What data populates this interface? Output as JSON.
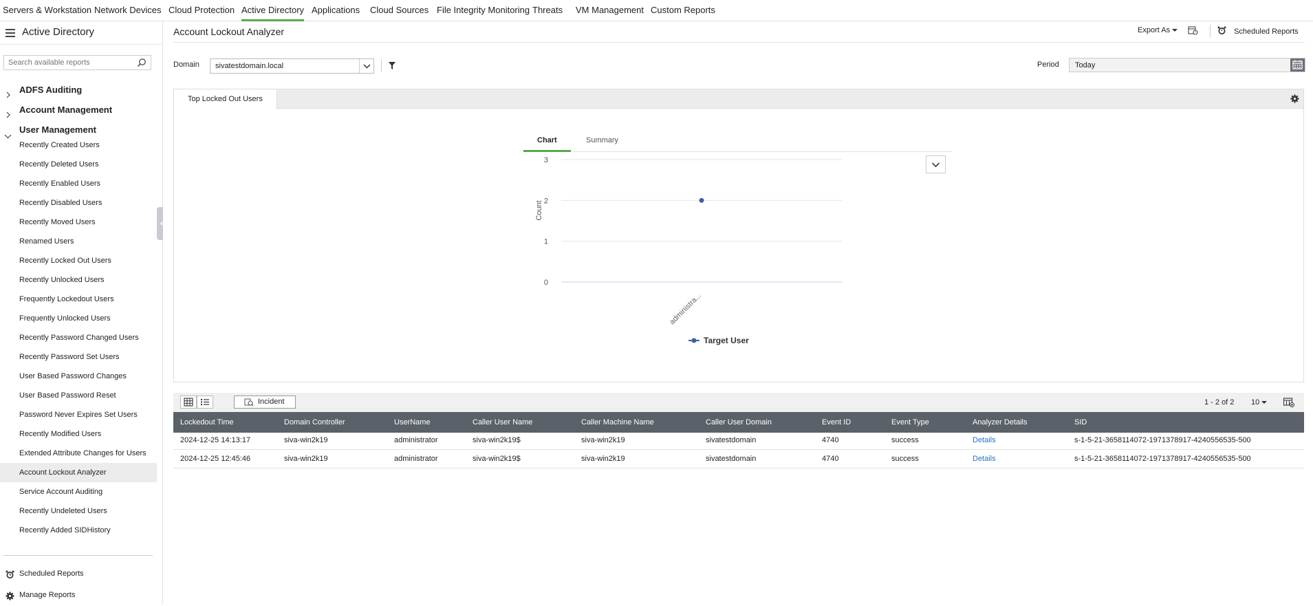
{
  "top_nav": [
    "Servers & Workstation",
    "Network Devices",
    "Cloud Protection",
    "Active Directory",
    "Applications",
    "Cloud Sources",
    "File Integrity Monitoring",
    "Threats",
    "VM Management",
    "Custom Reports"
  ],
  "top_nav_active": "Active Directory",
  "sidebar": {
    "title": "Active Directory",
    "search_placeholder": "Search available reports",
    "categories": [
      "ADFS Auditing",
      "Account Management",
      "User Management"
    ],
    "items": [
      "Recently Created Users",
      "Recently Deleted Users",
      "Recently Enabled Users",
      "Recently Disabled Users",
      "Recently Moved Users",
      "Renamed Users",
      "Recently Locked Out Users",
      "Recently Unlocked Users",
      "Frequently Lockedout Users",
      "Frequently Unlocked Users",
      "Recently Password Changed Users",
      "Recently Password Set Users",
      "User Based Password Changes",
      "User Based Password Reset",
      "Password Never Expires Set Users",
      "Recently Modified Users",
      "Extended Attribute Changes for Users",
      "Account Lockout Analyzer",
      "Service Account Auditing",
      "Recently Undeleted Users",
      "Recently Added SIDHistory"
    ],
    "active_item": "Account Lockout Analyzer",
    "bottom": {
      "scheduled": "Scheduled Reports",
      "manage": "Manage Reports"
    }
  },
  "header": {
    "title": "Account Lockout Analyzer",
    "export_label": "Export As",
    "scheduled_label": "Scheduled Reports"
  },
  "filters": {
    "domain_label": "Domain",
    "domain_value": "sivatestdomain.local",
    "period_label": "Period",
    "period_value": "Today"
  },
  "panel": {
    "tab": "Top Locked Out Users",
    "chart_tab": "Chart",
    "summary_tab": "Summary"
  },
  "chart_data": {
    "type": "line",
    "categories": [
      "administra..."
    ],
    "series": [
      {
        "name": "Target User",
        "values": [
          2
        ],
        "color": "#3f5fa8"
      }
    ],
    "ylabel": "Count",
    "xlabel": "",
    "ylim": [
      0,
      3
    ],
    "yticks": [
      "0",
      "1",
      "2",
      "3"
    ],
    "grid": true,
    "legend": "bottom"
  },
  "table": {
    "incident_label": "Incident",
    "pager_text": "1 - 2 of 2",
    "page_size": "10",
    "columns": [
      "Lockedout Time",
      "Domain Controller",
      "UserName",
      "Caller User Name",
      "Caller Machine Name",
      "Caller User Domain",
      "Event ID",
      "Event Type",
      "Analyzer Details",
      "SID"
    ],
    "rows": [
      [
        "2024-12-25 14:13:17",
        "siva-win2k19",
        "administrator",
        "siva-win2k19$",
        "siva-win2k19",
        "sivatestdomain",
        "4740",
        "success",
        "Details",
        "s-1-5-21-3658114072-1971378917-4240556535-500"
      ],
      [
        "2024-12-25 12:45:46",
        "siva-win2k19",
        "administrator",
        "siva-win2k19$",
        "siva-win2k19",
        "sivatestdomain",
        "4740",
        "success",
        "Details",
        "s-1-5-21-3658114072-1971378917-4240556535-500"
      ]
    ]
  },
  "colors": {
    "accent": "#5aa84d",
    "table_header": "#5b6168",
    "link": "#2a6fc0",
    "series": "#3f5fa8"
  }
}
